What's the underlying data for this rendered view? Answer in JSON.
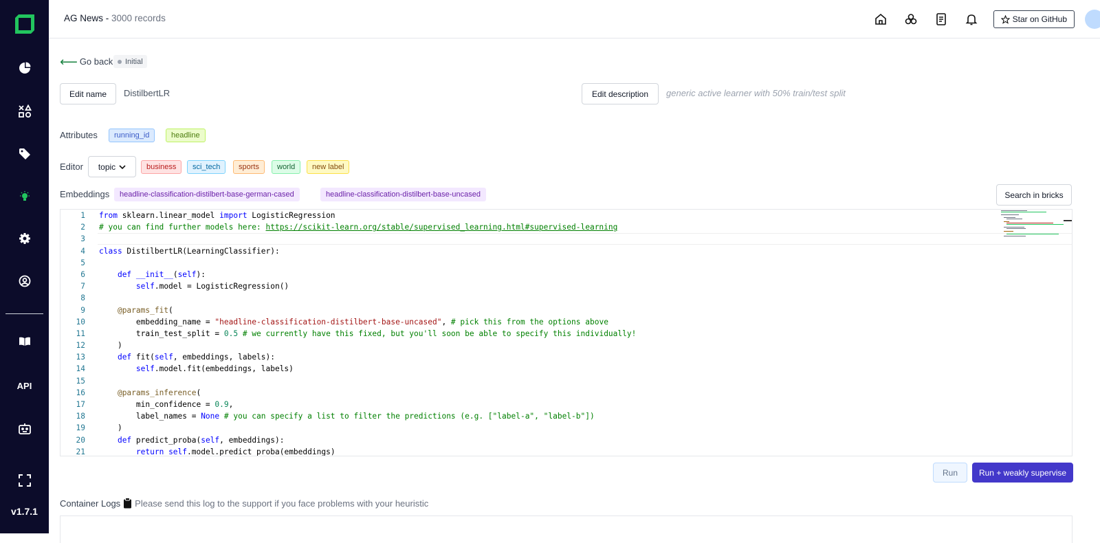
{
  "header": {
    "project": "AG News",
    "separator": " - ",
    "records": "3000 records",
    "github_label": "Star on GitHub"
  },
  "sidebar": {
    "items": [
      "overview-icon",
      "data-browser-icon",
      "labeling-icon",
      "heuristics-icon",
      "settings-icon",
      "users-icon",
      "docs-icon",
      "API",
      "support-icon",
      "fullscreen-icon"
    ],
    "version": "v1.7.1"
  },
  "page": {
    "go_back": "Go back",
    "status": "Initial",
    "edit_name_label": "Edit name",
    "name": "DistilbertLR",
    "edit_description_label": "Edit description",
    "description": "generic active learner with 50% train/test split",
    "attributes_label": "Attributes",
    "attributes": [
      "running_id",
      "headline"
    ],
    "editor_label": "Editor",
    "labeling_task": "topic",
    "labels": [
      "business",
      "sci_tech",
      "sports",
      "world",
      "new label"
    ],
    "embeddings_label": "Embeddings",
    "embeddings": [
      "headline-classification-distilbert-base-german-cased",
      "headline-classification-distilbert-base-uncased"
    ],
    "search_bricks_label": "Search in bricks",
    "run_label": "Run",
    "run_ws_label": "Run + weakly supervise",
    "logs_title": "Container Logs",
    "logs_hint": "Please send this log to the support if you face problems with your heuristic"
  },
  "code": {
    "l1": [
      "from",
      " sklearn.linear_model ",
      "import",
      " LogisticRegression"
    ],
    "l2": [
      "# you can find further models here: ",
      "https://scikit-learn.org/stable/supervised_learning.html#supervised-learning"
    ],
    "l4": [
      "class",
      " DistilbertLR(LearningClassifier):"
    ],
    "l6": [
      "    ",
      "def",
      " ",
      "__init__",
      "(",
      "self",
      "):"
    ],
    "l7": [
      "        ",
      "self",
      ".model = LogisticRegression()"
    ],
    "l9": [
      "    ",
      "@params_fit",
      "("
    ],
    "l10": [
      "        embedding_name = ",
      "\"headline-classification-distilbert-base-uncased\"",
      ", ",
      "# pick this from the options above"
    ],
    "l11": [
      "        train_test_split = ",
      "0.5",
      " ",
      "# we currently have this fixed, but you'll soon be able to specify this individually!"
    ],
    "l12": [
      "    )"
    ],
    "l13": [
      "    ",
      "def",
      " fit(",
      "self",
      ", embeddings, labels):"
    ],
    "l14": [
      "        ",
      "self",
      ".model.fit(embeddings, labels)"
    ],
    "l16": [
      "    ",
      "@params_inference",
      "("
    ],
    "l17": [
      "        min_confidence = ",
      "0.9",
      ","
    ],
    "l18": [
      "        label_names = ",
      "None",
      " ",
      "# you can specify a list to filter the predictions (e.g. [\"label-a\", \"label-b\"])"
    ],
    "l19": [
      "    )"
    ],
    "l20": [
      "    ",
      "def",
      " predict_proba(",
      "self",
      ", embeddings):"
    ],
    "l21": [
      "        ",
      "return",
      " ",
      "self",
      ".model.predict_proba(embeddings)"
    ]
  }
}
